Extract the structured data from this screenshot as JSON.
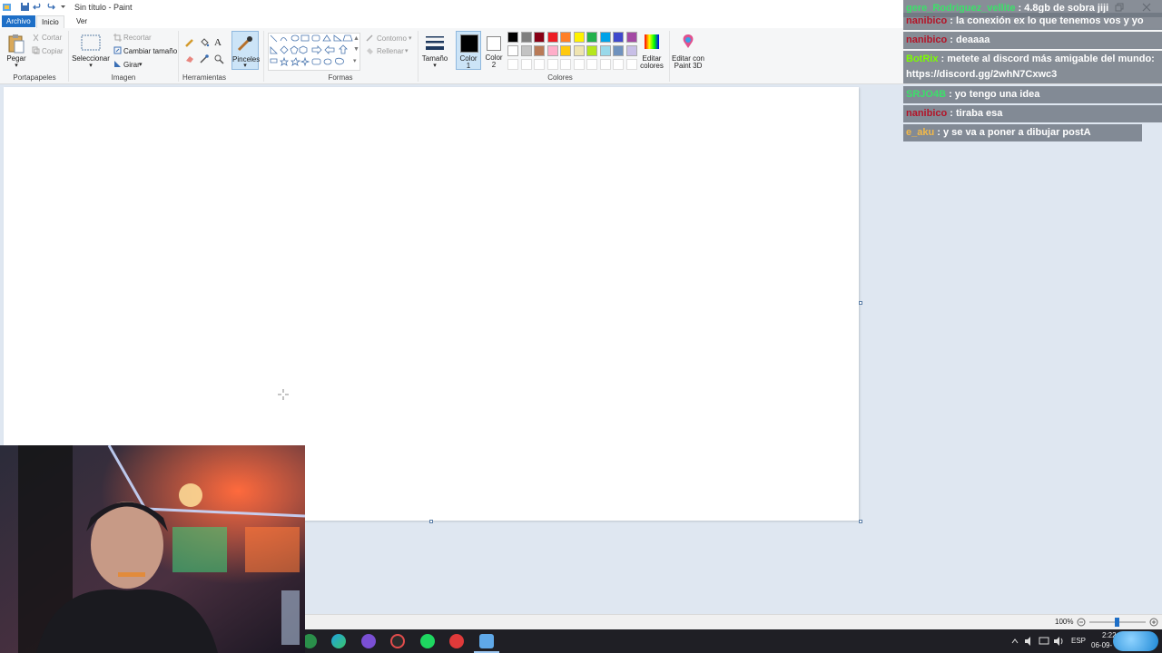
{
  "window": {
    "title": "Sin título - Paint"
  },
  "tabs": [
    {
      "label": "Archivo"
    },
    {
      "label": "Inicio"
    },
    {
      "label": "Ver"
    }
  ],
  "ribbon": {
    "clipboard": {
      "paste": "Pegar",
      "cut": "Cortar",
      "copy": "Copiar",
      "label": "Portapapeles"
    },
    "image": {
      "select": "Seleccionar",
      "crop": "Recortar",
      "resize": "Cambiar tamaño",
      "rotate": "Girar",
      "label": "Imagen"
    },
    "tools": {
      "brushes": "Pinceles",
      "label": "Herramientas"
    },
    "shapes": {
      "outline": "Contorno",
      "fill": "Rellenar",
      "label": "Formas"
    },
    "size": {
      "label": "Tamaño"
    },
    "colors": {
      "color1_line1": "Color",
      "color1_line2": "1",
      "color2_line1": "Color",
      "color2_line2": "2",
      "edit_line1": "Editar",
      "edit_line2": "colores",
      "paint3d_line1": "Editar con",
      "paint3d_line2": "Paint 3D",
      "label": "Colores",
      "color1": "#000000",
      "color2": "#ffffff",
      "palette_row1": [
        "#000000",
        "#7f7f7f",
        "#880015",
        "#ed1c24",
        "#ff7f27",
        "#fff200",
        "#22b14c",
        "#00a2e8",
        "#3f48cc",
        "#a349a4"
      ],
      "palette_row2": [
        "#ffffff",
        "#c3c3c3",
        "#b97a57",
        "#ffaec9",
        "#ffc90e",
        "#efe4b0",
        "#b5e61d",
        "#99d9ea",
        "#7092be",
        "#c8bfe7"
      ]
    }
  },
  "status": {
    "zoom": "100%"
  },
  "taskbar": {
    "language": "ESP",
    "time": "2:22",
    "date": "06-09-"
  },
  "chat": [
    {
      "user": "gere_Rodriguez_vellite",
      "text": " : 4.8gb de sobra jiji",
      "user_color": "#3ce06a"
    },
    {
      "user": "nanibico",
      "text": " : la conexión ex lo que tenemos vos y yo",
      "user_color": "#b31428"
    },
    {
      "user": "nanibico",
      "text": " : deaaaa",
      "user_color": "#b31428"
    },
    {
      "user": "BotRix",
      "text": " : metete al discord más amigable del mundo: https://discord.gg/2whN7Cxwc3",
      "user_color": "#7cfc00"
    },
    {
      "user": "SRJO4B",
      "text": " : yo tengo una idea",
      "user_color": "#3ce06a"
    },
    {
      "user": "nanibico",
      "text": " : tiraba esa",
      "user_color": "#b31428"
    },
    {
      "user": "e_aku",
      "text": " : y se va a poner a dibujar postA",
      "user_color": "#f2b94a"
    }
  ]
}
